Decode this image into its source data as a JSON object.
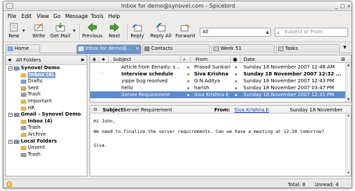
{
  "window": {
    "title": "Inbox for demo@synovel.com - Spicebird",
    "minimize": "_",
    "maximize": "□",
    "close": "×"
  },
  "menu": [
    "File",
    "Edit",
    "View",
    "Go",
    "Message",
    "Tools",
    "Help"
  ],
  "toolbar": {
    "buttons": [
      "New",
      "Write",
      "Get Mail",
      "Previous",
      "Next",
      "Reply",
      "Reply All",
      "Forward"
    ],
    "filter_value": "All",
    "search_placeholder": "Subject or From"
  },
  "tabs": [
    "Home",
    "Inbox for demo@...",
    "Contacts",
    "Week 51",
    "Tasks"
  ],
  "folders": {
    "header": "All Folders",
    "accounts": [
      {
        "name": "Synovel Demo",
        "items": [
          {
            "name": "Inbox (4)",
            "bold": true,
            "selected": true
          },
          {
            "name": "Drafts"
          },
          {
            "name": "Sent"
          },
          {
            "name": "Trash"
          },
          {
            "name": "Important"
          },
          {
            "name": "HR"
          }
        ]
      },
      {
        "name": "Gmail - Synovel Demo",
        "items": [
          {
            "name": "Inbox (4)",
            "bold": true
          },
          {
            "name": "Trash"
          },
          {
            "name": "Archive"
          }
        ]
      },
      {
        "name": "Local Folders",
        "items": [
          {
            "name": "Unsent"
          },
          {
            "name": "Trash"
          }
        ]
      }
    ]
  },
  "message_list": {
    "columns": [
      "Subject",
      "From",
      "Date"
    ],
    "rows": [
      {
        "subject": "Article from Eenadu: s...",
        "from": "Prasad Sunkari",
        "date": "Sunday 18 November 2007 12:46 AM",
        "bold": false,
        "selected": false
      },
      {
        "subject": "Interview schedule",
        "from": "Siva Krishna E",
        "date": "Sunday 18 November 2007 12:32 ...",
        "bold": true,
        "selected": false
      },
      {
        "subject": "yippe bug resolved",
        "from": "G.N.Aditya",
        "date": "Sunday 18 November 2007 12:43 PM",
        "bold": false,
        "selected": false
      },
      {
        "subject": "hello",
        "from": "harish",
        "date": "Sunday 18 November 2007 03:47 PM",
        "bold": false,
        "selected": false
      },
      {
        "subject": "Server Requirement",
        "from": "Siva Krishna E",
        "date": "Sunday 18 November 2007 12:31 PM",
        "bold": false,
        "selected": true
      }
    ]
  },
  "message_header": {
    "subject_label": "Subject:",
    "subject": "Server Requirement",
    "from_label": "From:",
    "from": "Siva Krishna E",
    "date": "Sunday 18 November"
  },
  "message_body": [
    "Hi John,",
    "We need to finalize the server requirements. Can we have a meeting at 12:30 tomorrow?",
    "Siva."
  ],
  "status": {
    "total": "Total: 8",
    "unread": "Unread: 4"
  },
  "colors": {
    "selection": "#5e8acb",
    "active_tab": "#6d93c9",
    "link": "#1a3fb5"
  }
}
